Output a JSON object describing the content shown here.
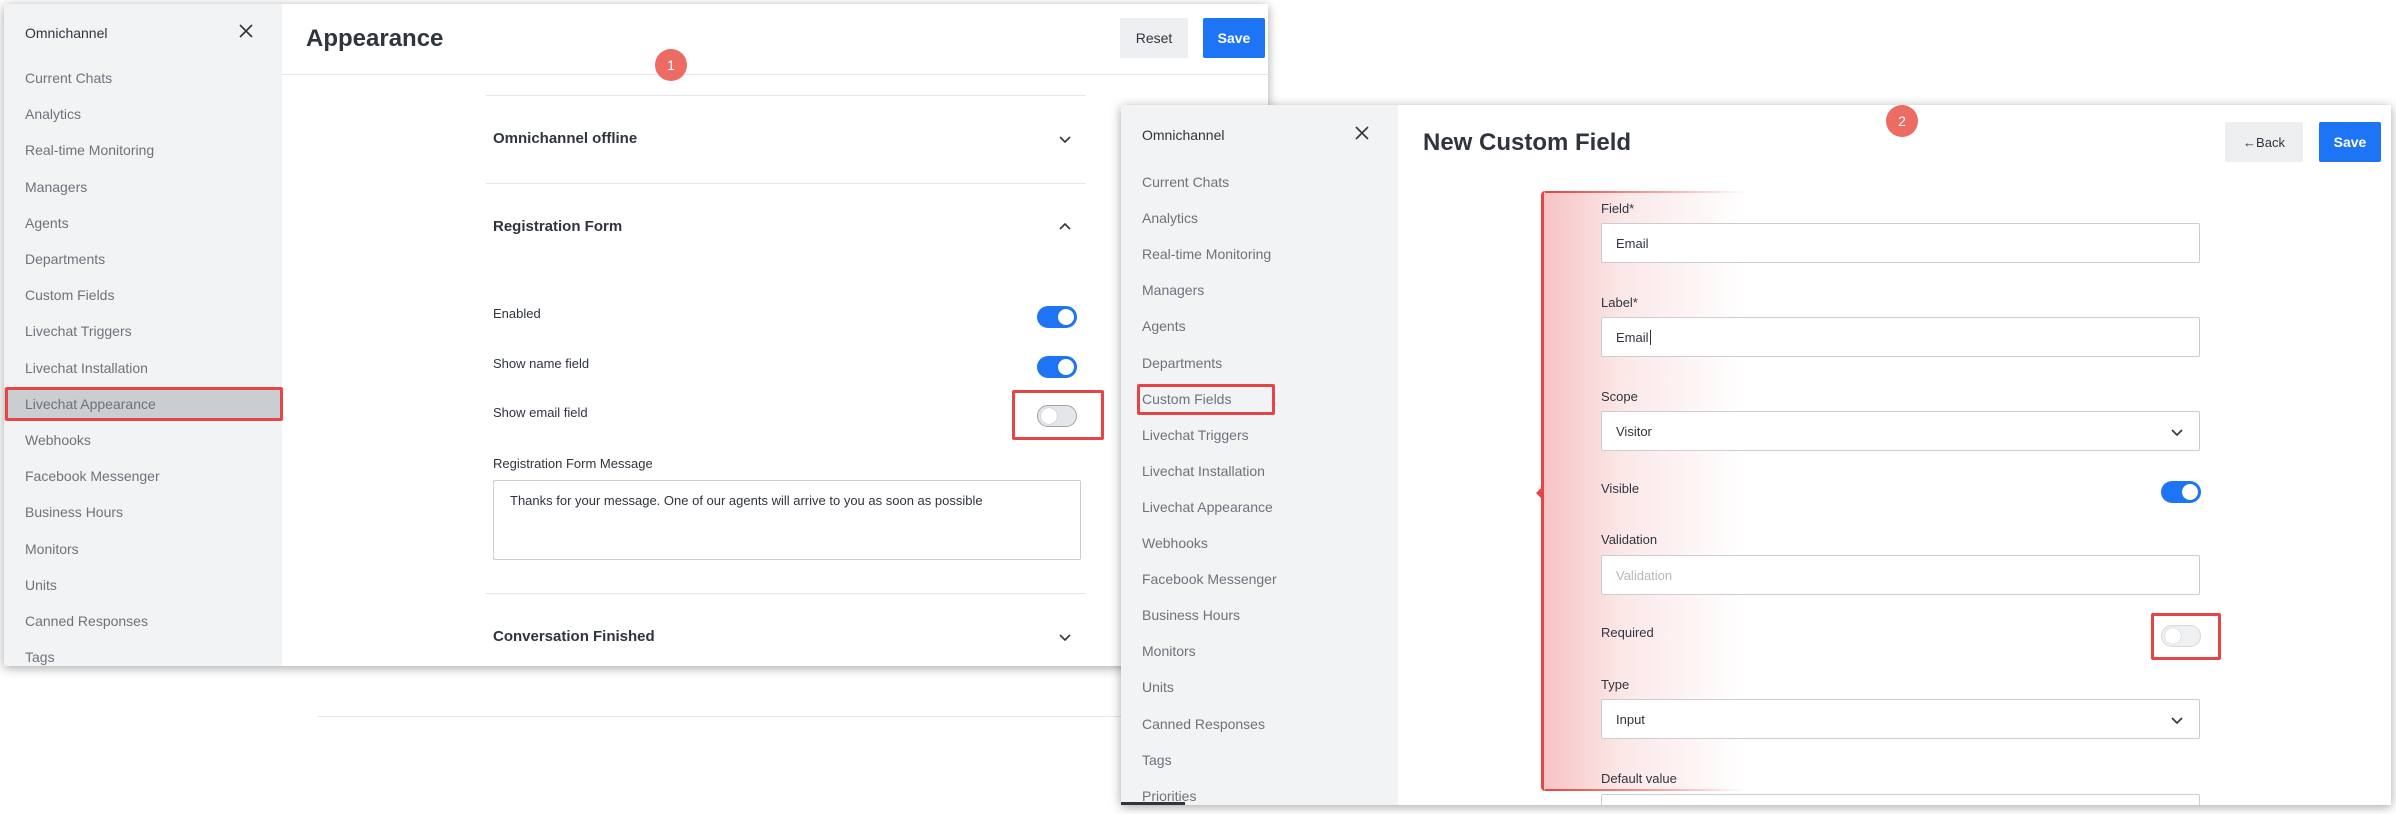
{
  "window1": {
    "sidebar": {
      "title": "Omnichannel",
      "items": [
        "Current Chats",
        "Analytics",
        "Real-time Monitoring",
        "Managers",
        "Agents",
        "Departments",
        "Custom Fields",
        "Livechat Triggers",
        "Livechat Installation",
        "Livechat Appearance",
        "Webhooks",
        "Facebook Messenger",
        "Business Hours",
        "Monitors",
        "Units",
        "Canned Responses",
        "Tags"
      ],
      "active_item": "Livechat Appearance"
    },
    "header": {
      "title": "Appearance",
      "reset_label": "Reset",
      "save_label": "Save"
    },
    "sections": {
      "offline_title": "Omnichannel offline",
      "registration_title": "Registration Form",
      "finished_title": "Conversation Finished"
    },
    "registration": {
      "enabled_label": "Enabled",
      "enabled": true,
      "show_name_label": "Show name field",
      "show_name": true,
      "show_email_label": "Show email field",
      "show_email": false,
      "message_label": "Registration Form Message",
      "message_value": "Thanks for your message. One of our agents will arrive to you as soon as possible"
    },
    "badge": "1"
  },
  "window2": {
    "sidebar": {
      "title": "Omnichannel",
      "items": [
        "Current Chats",
        "Analytics",
        "Real-time Monitoring",
        "Managers",
        "Agents",
        "Departments",
        "Custom Fields",
        "Livechat Triggers",
        "Livechat Installation",
        "Livechat Appearance",
        "Webhooks",
        "Facebook Messenger",
        "Business Hours",
        "Monitors",
        "Units",
        "Canned Responses",
        "Tags",
        "Priorities"
      ],
      "active_item": "Custom Fields"
    },
    "header": {
      "title": "New Custom Field",
      "back_label": "←Back",
      "save_label": "Save"
    },
    "form": {
      "field_label": "Field*",
      "field_value": "Email",
      "label_label": "Label*",
      "label_value": "Email",
      "scope_label": "Scope",
      "scope_value": "Visitor",
      "visible_label": "Visible",
      "visible": true,
      "validation_label": "Validation",
      "validation_placeholder": "Validation",
      "required_label": "Required",
      "required": false,
      "type_label": "Type",
      "type_value": "Input",
      "default_label": "Default value"
    },
    "badge": "2"
  },
  "colors": {
    "accent": "#1d74f5",
    "highlight": "#e54545",
    "badge": "#ec6b62",
    "sidebar_bg": "#f2f3f5"
  }
}
